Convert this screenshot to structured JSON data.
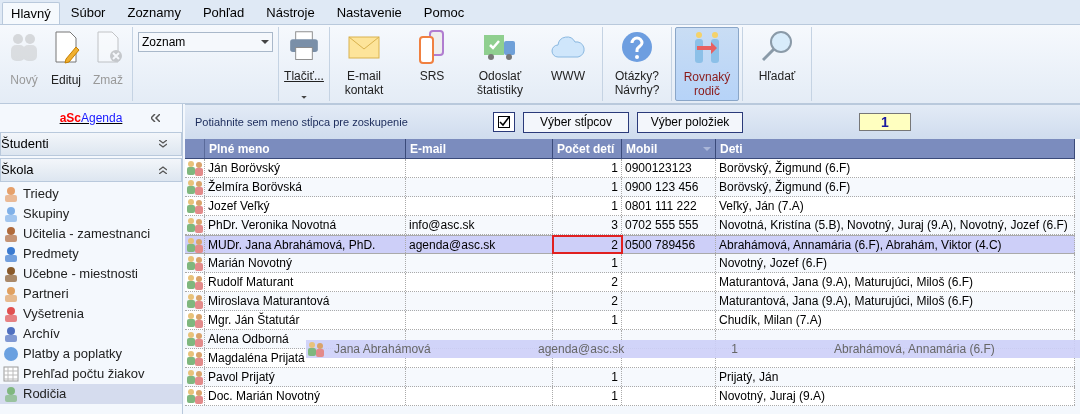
{
  "ribbon": {
    "tabs": [
      {
        "label": "Hlavný",
        "selected": true
      },
      {
        "label": "Súbor",
        "selected": false
      },
      {
        "label": "Zoznamy",
        "selected": false
      },
      {
        "label": "Pohľad",
        "selected": false
      },
      {
        "label": "Nástroje",
        "selected": false
      },
      {
        "label": "Nastavenie",
        "selected": false
      },
      {
        "label": "Pomoc",
        "selected": false
      }
    ],
    "record_buttons": [
      {
        "label": "Nový",
        "disabled": true
      },
      {
        "label": "Edituj",
        "disabled": false
      },
      {
        "label": "Zmaž",
        "disabled": true
      }
    ],
    "list_select": {
      "value": "Zoznam"
    },
    "print_button": {
      "label": "Tlačiť..."
    },
    "action_buttons": [
      {
        "label": "E-mail kontakt",
        "pressed": false
      },
      {
        "label": "SRS",
        "pressed": false
      },
      {
        "label": "Odoslať štatistiky",
        "pressed": false
      },
      {
        "label": "WWW",
        "pressed": false
      },
      {
        "label": "Otázky? Návrhy?",
        "pressed": false
      },
      {
        "label": "Rovnaký rodič",
        "pressed": true
      },
      {
        "label": "Hľadať",
        "pressed": false
      }
    ]
  },
  "sidebar": {
    "logo": {
      "prefix": "aSc",
      "suffix": "Agenda"
    },
    "sections": [
      {
        "label": "Študenti",
        "expanded": false
      },
      {
        "label": "Škola",
        "expanded": true,
        "items": [
          {
            "label": "Triedy",
            "selected": false
          },
          {
            "label": "Skupiny",
            "selected": false
          },
          {
            "label": "Učitelia - zamestnanci",
            "selected": false
          },
          {
            "label": "Predmety",
            "selected": false
          },
          {
            "label": "Učebne - miestnosti",
            "selected": false
          },
          {
            "label": "Partneri",
            "selected": false
          },
          {
            "label": "Vyšetrenia",
            "selected": false
          },
          {
            "label": "Archív",
            "selected": false
          },
          {
            "label": "Platby a poplatky",
            "selected": false
          },
          {
            "label": "Prehľad počtu žiakov",
            "selected": false
          },
          {
            "label": "Rodičia",
            "selected": true
          }
        ]
      }
    ]
  },
  "grid": {
    "group_hint": "Potiahnite sem meno stĺpca pre zoskupenie",
    "filter_checked": true,
    "buttons": [
      "Výber stĺpcov",
      "Výber položiek"
    ],
    "count": "1",
    "columns": [
      "Plné meno",
      "E-mail",
      "Počet detí",
      "Mobil",
      "Deti"
    ],
    "rows": [
      {
        "name": "Ján Borövský",
        "email": "",
        "count": "1",
        "mobile": "0900123123",
        "children": "Borövský, Žigmund (6.F)",
        "selected": false,
        "marked": false
      },
      {
        "name": "Želmíra Borövská",
        "email": "",
        "count": "1",
        "mobile": "0900 123 456",
        "children": "Borövský, Žigmund (6.F)",
        "selected": false,
        "marked": false
      },
      {
        "name": "Jozef Veľký",
        "email": "",
        "count": "1",
        "mobile": "0801 111 222",
        "children": "Veľký, Ján (7.A)",
        "selected": false,
        "marked": false
      },
      {
        "name": "PhDr. Veronika Novotná",
        "email": "info@asc.sk",
        "count": "3",
        "mobile": "0702 555 555",
        "children": "Novotná, Kristína (5.B), Novotný, Juraj (9.A), Novotný, Jozef (6.F)",
        "selected": false,
        "marked": false
      },
      {
        "name": "MUDr. Jana Abrahámová, PhD.",
        "email": "agenda@asc.sk",
        "count": "2",
        "mobile": "0500 789456",
        "children": "Abrahámová, Annamária (6.F), Abrahám, Viktor (4.C)",
        "selected": true,
        "marked": true
      },
      {
        "name": "Marián Novotný",
        "email": "",
        "count": "1",
        "mobile": "",
        "children": "Novotný, Jozef (6.F)",
        "selected": false,
        "marked": false
      },
      {
        "name": "Rudolf Maturant",
        "email": "",
        "count": "2",
        "mobile": "",
        "children": "Maturantová, Jana (9.A), Maturujúci, Miloš (6.F)",
        "selected": false,
        "marked": false
      },
      {
        "name": "Miroslava Maturantová",
        "email": "",
        "count": "2",
        "mobile": "",
        "children": "Maturantová, Jana (9.A), Maturujúci, Miloš (6.F)",
        "selected": false,
        "marked": false
      },
      {
        "name": "Mgr. Ján Štatutár",
        "email": "",
        "count": "1",
        "mobile": "",
        "children": "Chudík, Milan (7.A)",
        "selected": false,
        "marked": false
      },
      {
        "name": "Alena Odborná",
        "email": "",
        "count": "",
        "mobile": "",
        "children": "",
        "selected": false,
        "marked": false
      },
      {
        "name": "Magdaléna Prijatá",
        "email": "",
        "count": "",
        "mobile": "",
        "children": "",
        "selected": false,
        "marked": false
      },
      {
        "name": "Pavol Prijatý",
        "email": "",
        "count": "1",
        "mobile": "",
        "children": "Prijatý, Ján",
        "selected": false,
        "marked": false
      },
      {
        "name": "Doc. Marián Novotný",
        "email": "",
        "count": "1",
        "mobile": "",
        "children": "Novotný, Juraj (9.A)",
        "selected": false,
        "marked": false
      }
    ],
    "drag_row": {
      "name": "Jana Abrahámová",
      "email": "agenda@asc.sk",
      "count": "1",
      "children": "Abrahámová, Annamária (6.F)"
    }
  }
}
